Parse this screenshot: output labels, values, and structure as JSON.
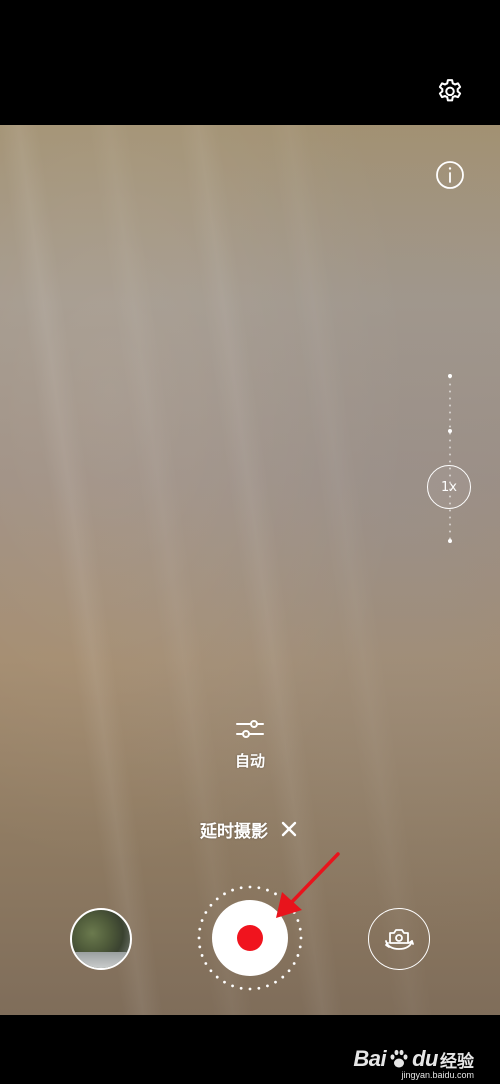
{
  "top_bar": {
    "settings_icon": "gear-icon"
  },
  "viewfinder": {
    "info_icon": "info-icon",
    "zoom": {
      "label": "1x"
    },
    "auto_control": {
      "icon": "sliders-icon",
      "label": "自动"
    },
    "mode": {
      "label": "延时摄影",
      "close_icon": "close-icon"
    }
  },
  "bottom_controls": {
    "gallery_icon": "gallery-thumbnail",
    "shutter": {
      "icon": "record-icon",
      "ring_color": "#ffffff",
      "dot_color": "#f0141e"
    },
    "switch_camera_icon": "camera-switch-icon"
  },
  "annotation": {
    "arrow_color": "#e8141c"
  },
  "watermark": {
    "logo": "Bai",
    "logo_suffix": "du",
    "text": "经验",
    "url": "jingyan.baidu.com"
  }
}
